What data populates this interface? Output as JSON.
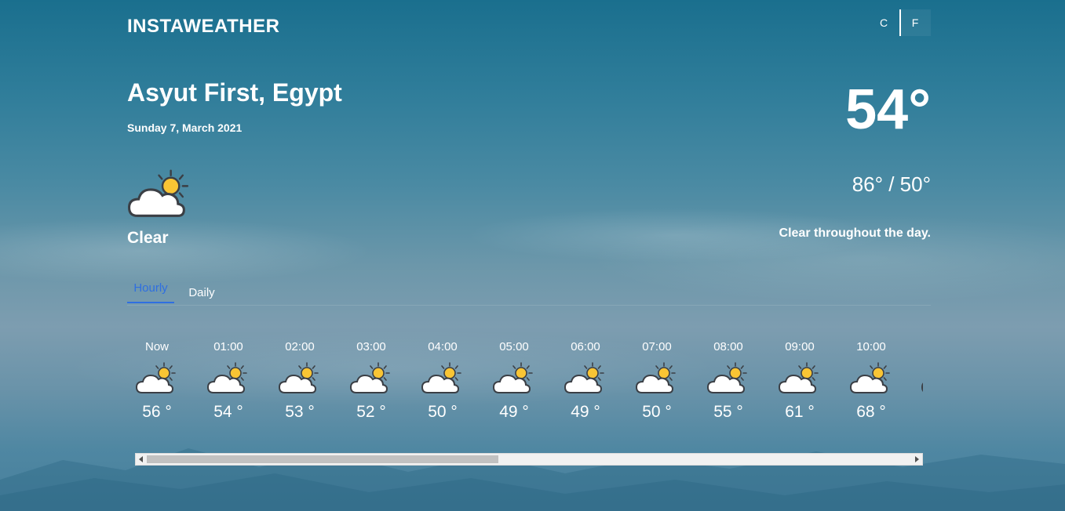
{
  "header": {
    "app_title": "INSTAWEATHER",
    "unit_c": "C",
    "unit_f": "F",
    "active_unit": "F"
  },
  "current": {
    "location": "Asyut First, Egypt",
    "date": "Sunday 7, March 2021",
    "condition": "Clear",
    "icon": "partly-cloudy-icon",
    "temperature": "54°",
    "hi_lo": "86° / 50°",
    "summary": "Clear throughout the day."
  },
  "tabs": [
    {
      "label": "Hourly",
      "active": true
    },
    {
      "label": "Daily",
      "active": false
    }
  ],
  "hourly": [
    {
      "time": "Now",
      "temp": "56 °",
      "icon": "partly-cloudy-icon"
    },
    {
      "time": "01:00",
      "temp": "54 °",
      "icon": "partly-cloudy-icon"
    },
    {
      "time": "02:00",
      "temp": "53 °",
      "icon": "partly-cloudy-icon"
    },
    {
      "time": "03:00",
      "temp": "52 °",
      "icon": "partly-cloudy-icon"
    },
    {
      "time": "04:00",
      "temp": "50 °",
      "icon": "partly-cloudy-icon"
    },
    {
      "time": "05:00",
      "temp": "49 °",
      "icon": "partly-cloudy-icon"
    },
    {
      "time": "06:00",
      "temp": "49 °",
      "icon": "partly-cloudy-icon"
    },
    {
      "time": "07:00",
      "temp": "50 °",
      "icon": "partly-cloudy-icon"
    },
    {
      "time": "08:00",
      "temp": "55 °",
      "icon": "partly-cloudy-icon"
    },
    {
      "time": "09:00",
      "temp": "61 °",
      "icon": "partly-cloudy-icon"
    },
    {
      "time": "10:00",
      "temp": "68 °",
      "icon": "partly-cloudy-icon"
    }
  ],
  "colors": {
    "sun": "#f9c534",
    "cloud_fill": "#ffffff",
    "outline": "#3b3f45",
    "active_tab": "#2f6fe0"
  }
}
